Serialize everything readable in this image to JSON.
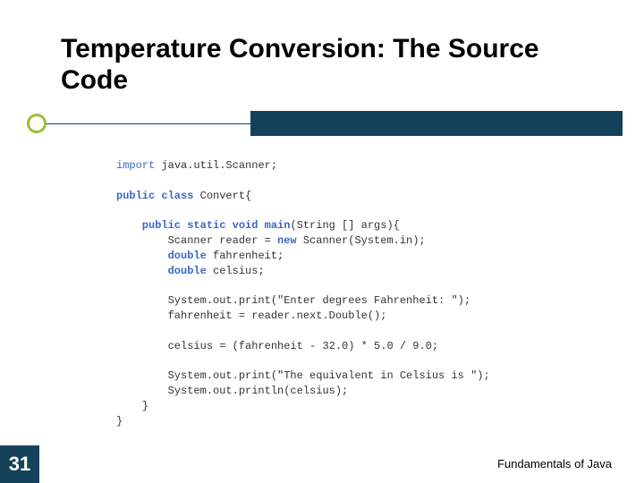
{
  "slide": {
    "title": "Temperature Conversion: The Source Code",
    "page_number": "31",
    "footer": "Fundamentals of Java"
  },
  "code": {
    "l1_a": "import",
    "l1_b": " java.util.Scanner;",
    "l2_a": "public class",
    "l2_b": " Convert{",
    "l3_a": "    public static void main",
    "l3_b": "(String [] args){",
    "l4_a": "        Scanner reader = ",
    "l4_b": "new",
    "l4_c": " Scanner(System.in);",
    "l5_a": "        ",
    "l5_b": "double",
    "l5_c": " fahrenheit;",
    "l6_a": "        ",
    "l6_b": "double",
    "l6_c": " celsius;",
    "l7": "        System.out.print(\"Enter degrees Fahrenheit: \");",
    "l8": "        fahrenheit = reader.next.Double();",
    "l9": "        celsius = (fahrenheit - 32.0) * 5.0 / 9.0;",
    "l10": "        System.out.print(\"The equivalent in Celsius is \");",
    "l11": "        System.out.println(celsius);",
    "l12": "    }",
    "l13": "}"
  }
}
